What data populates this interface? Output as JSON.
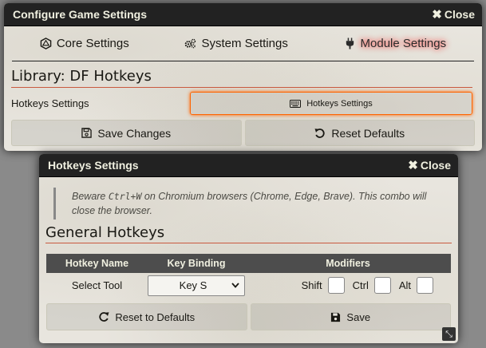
{
  "settings_window": {
    "title": "Configure Game Settings",
    "close_label": "Close",
    "tabs": [
      {
        "label": "Core Settings",
        "icon": "dice-d20-icon"
      },
      {
        "label": "System Settings",
        "icon": "cogs-icon"
      },
      {
        "label": "Module Settings",
        "icon": "plug-icon",
        "active": true
      }
    ],
    "library_title": "Library: DF Hotkeys",
    "setting_label": "Hotkeys Settings",
    "setting_button_label": "Hotkeys Settings",
    "save_label": "Save Changes",
    "reset_label": "Reset Defaults"
  },
  "hotkeys_window": {
    "title": "Hotkeys Settings",
    "close_label": "Close",
    "notice_pre": "Beware ",
    "notice_code": "Ctrl+W",
    "notice_post": " on Chromium browsers (Chrome, Edge, Brave). This combo will close the browser.",
    "section_title": "General Hotkeys",
    "columns": {
      "name": "Hotkey Name",
      "binding": "Key Binding",
      "modifiers": "Modifiers"
    },
    "rows": [
      {
        "name": "Select Tool",
        "key": "Key S",
        "shift_label": "Shift",
        "ctrl_label": "Ctrl",
        "alt_label": "Alt"
      }
    ],
    "reset_label": "Reset to Defaults",
    "save_label": "Save"
  },
  "colors": {
    "header_bg": "#222222",
    "accent_underline": "#c9593f",
    "active_glow": "#ff0000",
    "highlight_border": "#ff6400"
  }
}
